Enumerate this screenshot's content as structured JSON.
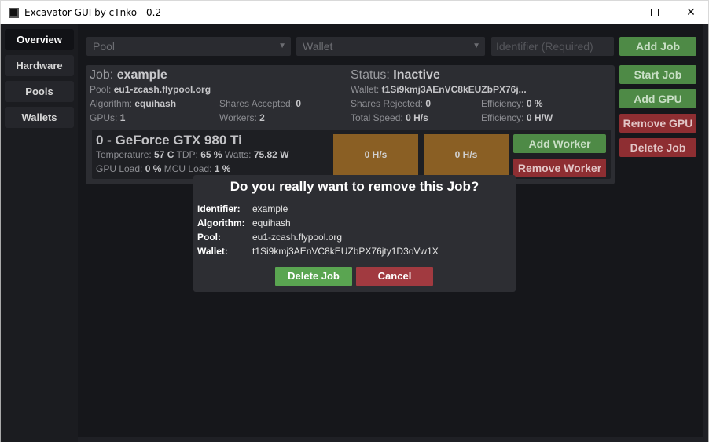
{
  "window": {
    "title": "Excavator GUI by cTnko - 0.2",
    "close_glyph": "✕"
  },
  "sidebar": {
    "items": [
      {
        "label": "Overview"
      },
      {
        "label": "Hardware"
      },
      {
        "label": "Pools"
      },
      {
        "label": "Wallets"
      }
    ]
  },
  "toolbar": {
    "pool_placeholder": "Pool",
    "wallet_placeholder": "Wallet",
    "identifier_placeholder": "Identifier (Required)",
    "add_job": "Add Job"
  },
  "actions": {
    "start_job": "Start Job",
    "add_gpu": "Add GPU",
    "remove_gpu": "Remove GPU",
    "delete_job": "Delete Job"
  },
  "job": {
    "job_label": "Job:",
    "name": "example",
    "status_label": "Status:",
    "status": "Inactive",
    "pool_label": "Pool:",
    "pool": "eu1-zcash.flypool.org",
    "wallet_label": "Wallet:",
    "wallet": "t1Si9kmj3AEnVC8kEUZbPX76j...",
    "algorithm_label": "Algorithm:",
    "algorithm": "equihash",
    "shares_accepted_label": "Shares Accepted:",
    "shares_accepted": "0",
    "shares_rejected_label": "Shares Rejected:",
    "shares_rejected": "0",
    "efficiency_label": "Efficiency:",
    "efficiency": "0 %",
    "gpus_label": "GPUs:",
    "gpus": "1",
    "workers_label": "Workers:",
    "workers": "2",
    "total_speed_label": "Total Speed:",
    "total_speed": "0 H/s",
    "efficiency2_label": "Efficiency:",
    "efficiency2": "0 H/W"
  },
  "gpu": {
    "name": "0 - GeForce GTX 980 Ti",
    "temperature_label": "Temperature:",
    "temperature": "57 C",
    "tdp_label": "TDP:",
    "tdp": "65 %",
    "watts_label": "Watts:",
    "watts": "75.82 W",
    "gpu_load_label": "GPU Load:",
    "gpu_load": "0 %",
    "mcu_load_label": "MCU Load:",
    "mcu_load": "1 %",
    "hashrates": [
      "0 H/s",
      "0 H/s"
    ],
    "add_worker": "Add Worker",
    "remove_worker": "Remove Worker"
  },
  "dialog": {
    "title": "Do you really want to remove this Job?",
    "rows": [
      {
        "label": "Identifier:",
        "value": "example"
      },
      {
        "label": "Algorithm:",
        "value": "equihash"
      },
      {
        "label": "Pool:",
        "value": "eu1-zcash.flypool.org"
      },
      {
        "label": "Wallet:",
        "value": "t1Si9kmj3AEnVC8kEUZbPX76jty1D3oVw1X"
      }
    ],
    "confirm": "Delete Job",
    "cancel": "Cancel"
  },
  "colors": {
    "green": "#5aa551",
    "red": "#a13a40",
    "hash_tile": "#8a5f24"
  }
}
